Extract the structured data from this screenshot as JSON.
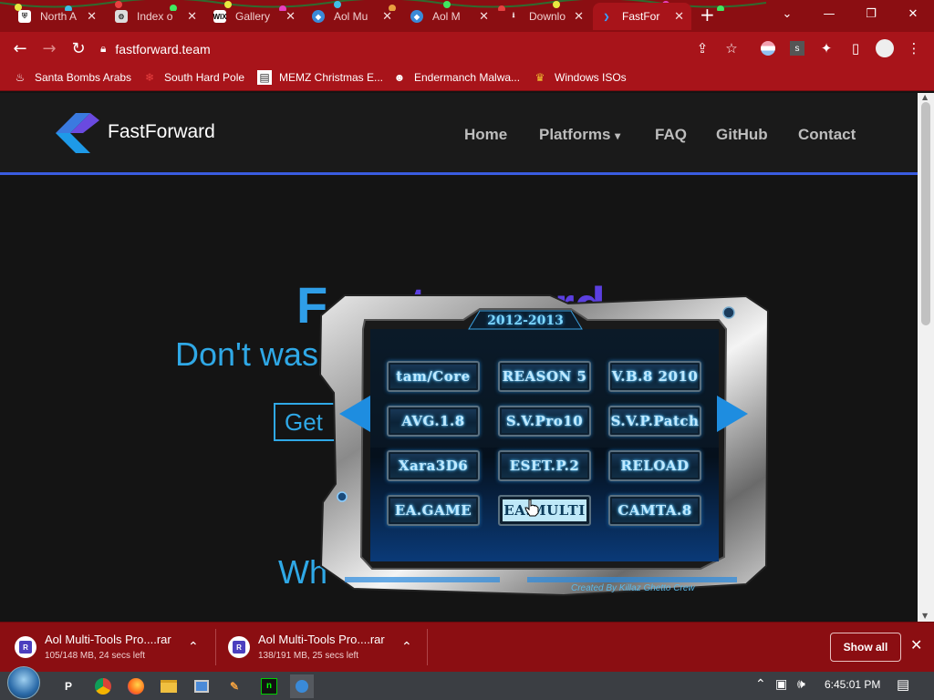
{
  "tabs": [
    {
      "title": "North A",
      "icon": "shield-icon"
    },
    {
      "title": "Index o",
      "icon": "gear-icon"
    },
    {
      "title": "Gallery",
      "icon": "wix-icon",
      "icon_text": "WIX"
    },
    {
      "title": "Aol Mu",
      "icon": "aol-icon"
    },
    {
      "title": "Aol M",
      "icon": "aol-icon"
    },
    {
      "title": "Downlo",
      "icon": "download-icon"
    },
    {
      "title": "FastFor",
      "icon": "fastforward-icon",
      "active": true
    }
  ],
  "address": "fastforward.team",
  "profile_letter": "s",
  "bookmarks": [
    {
      "label": "Santa Bombs Arabs",
      "icon": "fire-icon"
    },
    {
      "label": "South Hard Pole",
      "icon": "snowflake-icon"
    },
    {
      "label": "MEMZ Christmas E...",
      "icon": "page-icon"
    },
    {
      "label": "Endermanch Malwa...",
      "icon": "cat-icon"
    },
    {
      "label": "Windows ISOs",
      "icon": "trophy-icon"
    }
  ],
  "site": {
    "brand": "FastForward",
    "nav": [
      "Home",
      "Platforms",
      "FAQ",
      "GitHub",
      "Contact"
    ],
    "hero_title_a": "F",
    "hero_title_b": "t",
    "hero_title_c": "rd",
    "hero_sub": "Don't was",
    "cta": "Get",
    "section": "Wh"
  },
  "popup": {
    "year": "2012-2013",
    "buttons": [
      "tam/Core",
      "REASON 5",
      "V.B.8 2010",
      "AVG.1.8",
      "S.V.Pro10",
      "S.V.P.Patch",
      "Xara3D6",
      "ESET.P.2",
      "RELOAD",
      "EA.GAME",
      "EA.MULTI",
      "CAMTA.8"
    ],
    "highlighted_index": 10,
    "credit": "Created By Killaz Ghetto Crew"
  },
  "downloads": [
    {
      "name": "Aol Multi-Tools Pro....rar",
      "status": "105/148 MB, 24 secs left"
    },
    {
      "name": "Aol Multi-Tools Pro....rar",
      "status": "138/191 MB, 25 secs left"
    }
  ],
  "show_all": "Show all",
  "clock": "6:45:01 PM",
  "colors": {
    "chrome_red": "#a8141a",
    "accent_blue": "#2fa8e6",
    "accent_purple": "#5b3fe0"
  }
}
